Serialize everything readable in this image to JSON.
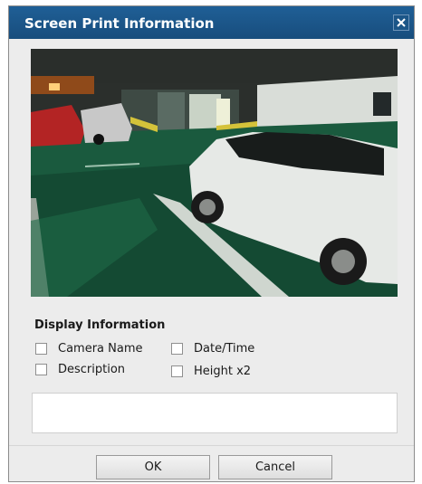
{
  "dialog": {
    "title": "Screen Print Information",
    "close_icon": "close-icon"
  },
  "preview": {
    "description": "Parking garage camera snapshot"
  },
  "display_information": {
    "heading": "Display Information",
    "options": {
      "camera_name": {
        "label": "Camera Name",
        "checked": false
      },
      "description": {
        "label": "Description",
        "checked": false
      },
      "date_time": {
        "label": "Date/Time",
        "checked": false
      },
      "height_x2": {
        "label": "Height x2",
        "checked": false
      }
    }
  },
  "text_field": {
    "value": ""
  },
  "buttons": {
    "ok": "OK",
    "cancel": "Cancel"
  },
  "colors": {
    "titlebar": "#1b5586",
    "dialog_bg": "#ececec"
  }
}
